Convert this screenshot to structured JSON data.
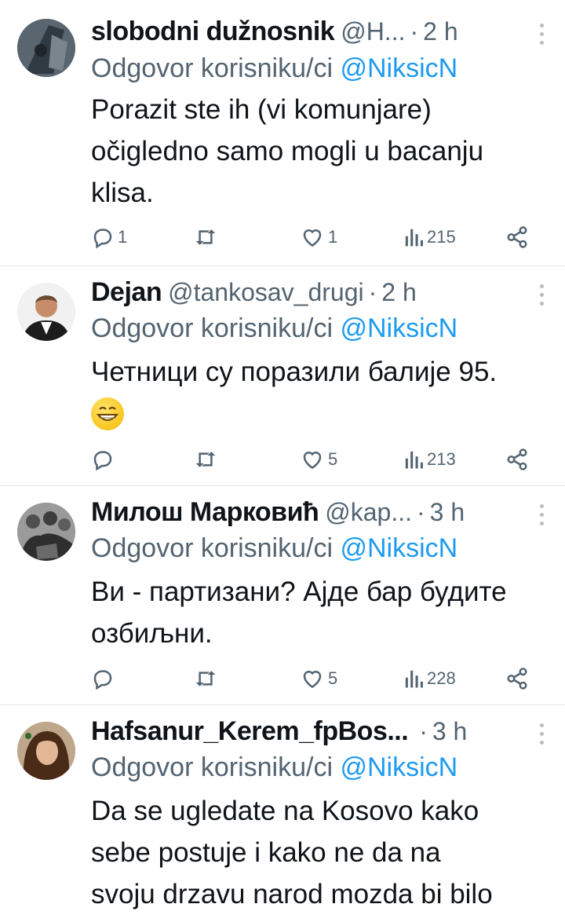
{
  "reply_prefix": "Odgovor korisniku/ci",
  "mention": "@NiksicN",
  "tweets": [
    {
      "name": "slobodni dužnosnik",
      "handle": "@H...",
      "dot": "·",
      "time": "2 h",
      "text_lines": [
        "Porazit ste ih (vi  komunjare)",
        "očigledno samo mogli  u bacanju",
        "klisa."
      ],
      "replies": "1",
      "retweets": "",
      "likes": "1",
      "views": "215"
    },
    {
      "name": "Dejan",
      "handle": "@tankosav_drugi",
      "dot": "·",
      "time": "2 h",
      "text_lines": [
        "Четници су поразили балије 95."
      ],
      "emoji": "grinning-face",
      "replies": "",
      "retweets": "",
      "likes": "5",
      "views": "213"
    },
    {
      "name": "Милош Марковић",
      "handle": "@kap...",
      "dot": "·",
      "time": "3 h",
      "text_lines": [
        "Ви - партизани? Ајде бар будите",
        "озбиљни."
      ],
      "replies": "",
      "retweets": "",
      "likes": "5",
      "views": "228"
    },
    {
      "name": "Hafsanur_Kerem_fpBos...",
      "handle": "",
      "dot": "·",
      "time": "3 h",
      "text_lines": [
        "Da se ugledate na Kosovo kako",
        "sebe postuje i kako ne da na",
        "svoju drzavu narod mozda bi bilo"
      ],
      "replies": "",
      "retweets": "",
      "likes": "",
      "views": ""
    }
  ],
  "icons": {
    "reply": "reply-icon",
    "retweet": "retweet-icon",
    "like": "like-icon",
    "views": "views-icon",
    "share": "share-icon",
    "more": "more-icon"
  },
  "colors": {
    "link": "#1d9bf0",
    "secondary": "#536471",
    "text": "#0f1419",
    "divider": "#e3e7ea"
  }
}
